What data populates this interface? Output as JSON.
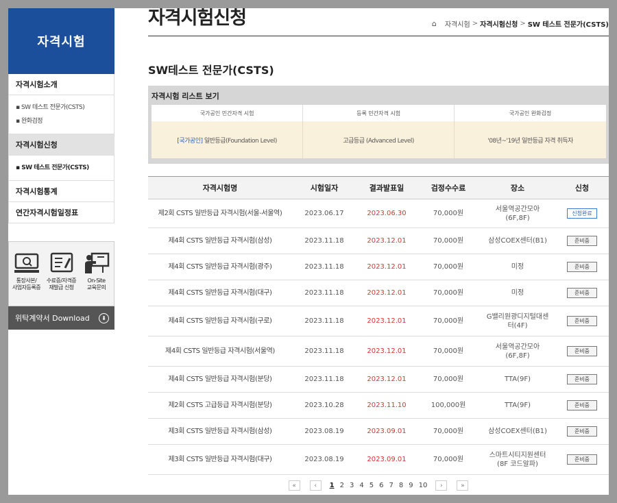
{
  "sidebar": {
    "title": "자격시험",
    "menu1": "자격시험소개",
    "sub1": [
      "SW 테스트 전문가(CSTS)",
      "완화검정"
    ],
    "menu2": "자격시험신청",
    "sub2": [
      "SW 테스트 전문가(CSTS)"
    ],
    "menu3": "자격시험통계",
    "menu4": "연간자격시험일정표",
    "quick": [
      {
        "icon": "registration-icon",
        "line1": "통장사본/",
        "line2": "사업자등록증"
      },
      {
        "icon": "application-form-icon",
        "line1": "수료증/자격증",
        "line2": "재발급 신청"
      },
      {
        "icon": "onsite-training-icon",
        "line1": "On-Site",
        "line2": "교육문의"
      }
    ],
    "download_label": "위탁계약서 Download"
  },
  "header": {
    "page_title": "자격시험신청",
    "breadcrumb": [
      "자격시험",
      "자격시험신청",
      "SW 테스트 전문가(CSTS)"
    ]
  },
  "section_title": "SW테스트 전문가(CSTS)",
  "grade_box": {
    "title": "자격시험 리스트 보기",
    "headers": [
      "국가공인 민간자격 시험",
      "등록 민간자격 시험",
      "국가공인 완화검정"
    ],
    "cells": [
      {
        "prefix": "[국가공인]",
        "text": " 일반등급(Foundation Level)"
      },
      {
        "prefix": "",
        "text": "고급등급 (Advanced Level)"
      },
      {
        "prefix": "",
        "text": "'08년~'19년 일반등급 자격 취득자"
      }
    ]
  },
  "exam_table": {
    "headers": [
      "자격시험명",
      "시험일자",
      "결과발표일",
      "검정수수료",
      "장소",
      "신청"
    ],
    "rows": [
      {
        "name": "제2회 CSTS 일반등급 자격시험(서울-서울역)",
        "date": "2023.06.17",
        "result": "2023.06.30",
        "fee": "70,000원",
        "place1": "서울역공간모아",
        "place2": "(6F,8F)",
        "status": "신청완료"
      },
      {
        "name": "제4회 CSTS 일반등급 자격시험(삼성)",
        "date": "2023.11.18",
        "result": "2023.12.01",
        "fee": "70,000원",
        "place1": "삼성COEX센터(B1)",
        "place2": "",
        "status": "준비중"
      },
      {
        "name": "제4회 CSTS 일반등급 자격시험(광주)",
        "date": "2023.11.18",
        "result": "2023.12.01",
        "fee": "70,000원",
        "place1": "미정",
        "place2": "",
        "status": "준비중"
      },
      {
        "name": "제4회 CSTS 일반등급 자격시험(대구)",
        "date": "2023.11.18",
        "result": "2023.12.01",
        "fee": "70,000원",
        "place1": "미정",
        "place2": "",
        "status": "준비중"
      },
      {
        "name": "제4회 CSTS 일반등급 자격시험(구로)",
        "date": "2023.11.18",
        "result": "2023.12.01",
        "fee": "70,000원",
        "place1": "G밸리원광디지털대센",
        "place2": "터(4F)",
        "status": "준비중"
      },
      {
        "name": "제4회 CSTS 일반등급 자격시험(서울역)",
        "date": "2023.11.18",
        "result": "2023.12.01",
        "fee": "70,000원",
        "place1": "서울역공간모아",
        "place2": "(6F,8F)",
        "status": "준비중"
      },
      {
        "name": "제4회 CSTS 일반등급 자격시험(분당)",
        "date": "2023.11.18",
        "result": "2023.12.01",
        "fee": "70,000원",
        "place1": "TTA(9F)",
        "place2": "",
        "status": "준비중"
      },
      {
        "name": "제2회 CSTS 고급등급 자격시험(분당)",
        "date": "2023.10.28",
        "result": "2023.11.10",
        "fee": "100,000원",
        "place1": "TTA(9F)",
        "place2": "",
        "status": "준비중"
      },
      {
        "name": "제3회 CSTS 일반등급 자격시험(삼성)",
        "date": "2023.08.19",
        "result": "2023.09.01",
        "fee": "70,000원",
        "place1": "삼성COEX센터(B1)",
        "place2": "",
        "status": "준비중"
      },
      {
        "name": "제3회 CSTS 일반등급 자격시험(대구)",
        "date": "2023.08.19",
        "result": "2023.09.01",
        "fee": "70,000원",
        "place1": "스마트시티지원센터",
        "place2": "(8F 코드알파)",
        "status": "준비중"
      }
    ]
  },
  "pagination": {
    "first": "«",
    "prev": "‹",
    "next": "›",
    "last": "»",
    "pages": [
      "1",
      "2",
      "3",
      "4",
      "5",
      "6",
      "7",
      "8",
      "9",
      "10"
    ],
    "current": "1"
  },
  "colors": {
    "brand": "#1b4f9b",
    "result_date": "#e23232",
    "badge_done": "#2b62b5"
  }
}
